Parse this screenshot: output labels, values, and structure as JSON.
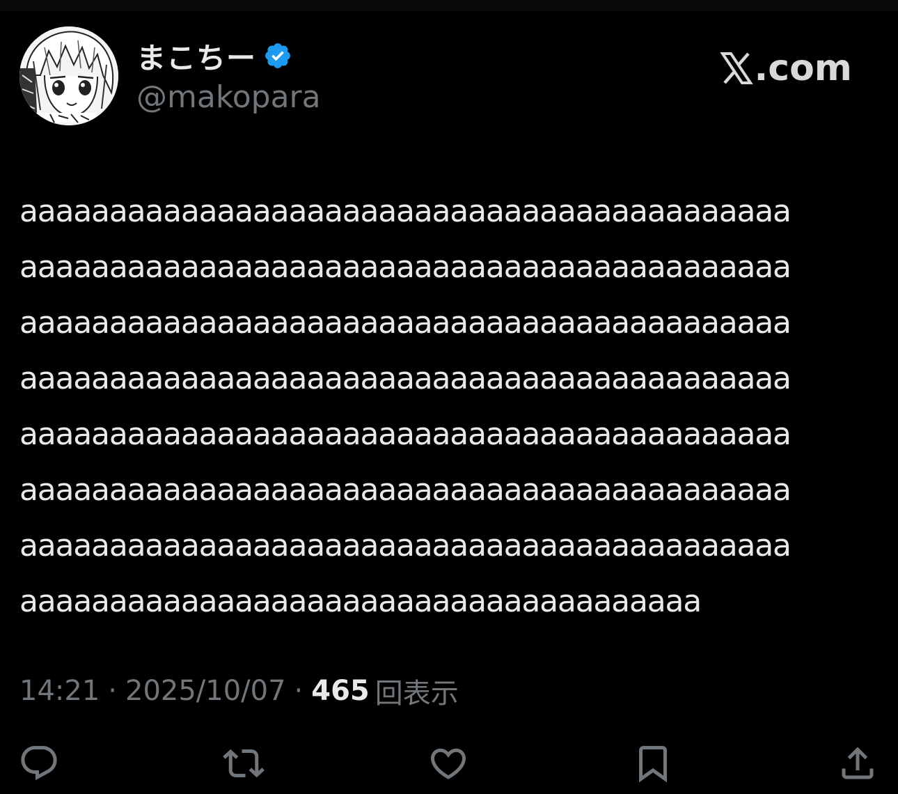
{
  "colors": {
    "background": "#000000",
    "primary_text": "#e7e9ea",
    "secondary_text": "#71767b",
    "verified_badge": "#1d9bf0"
  },
  "author": {
    "display_name": "まこちー",
    "handle": "@makopara",
    "verified": true,
    "avatar_icon": "avatar-image"
  },
  "brand": {
    "logo_icon": "x-logo-icon",
    "text": ".com"
  },
  "tweet": {
    "lines": [
      "aaaaaaaaaaaaaaaaaaaaaaaaaaaaaaaaaaaaaaaaaaa",
      "aaaaaaaaaaaaaaaaaaaaaaaaaaaaaaaaaaaaaaaaaaa",
      "aaaaaaaaaaaaaaaaaaaaaaaaaaaaaaaaaaaaaaaaaaa",
      "aaaaaaaaaaaaaaaaaaaaaaaaaaaaaaaaaaaaaaaaaaa",
      "aaaaaaaaaaaaaaaaaaaaaaaaaaaaaaaaaaaaaaaaaaa",
      "aaaaaaaaaaaaaaaaaaaaaaaaaaaaaaaaaaaaaaaaaaa",
      "aaaaaaaaaaaaaaaaaaaaaaaaaaaaaaaaaaaaaaaaaaa",
      "aaaaaaaaaaaaaaaaaaaaaaaaaaaaaaaaaaaaaa"
    ]
  },
  "meta": {
    "time": "14:21",
    "separator": "·",
    "date": "2025/10/07",
    "views_count": "465",
    "views_label": "回表示"
  },
  "actions": [
    {
      "name": "reply",
      "icon": "reply-icon"
    },
    {
      "name": "repost",
      "icon": "repost-icon"
    },
    {
      "name": "like",
      "icon": "heart-icon"
    },
    {
      "name": "bookmark",
      "icon": "bookmark-icon"
    },
    {
      "name": "share",
      "icon": "share-icon"
    }
  ]
}
